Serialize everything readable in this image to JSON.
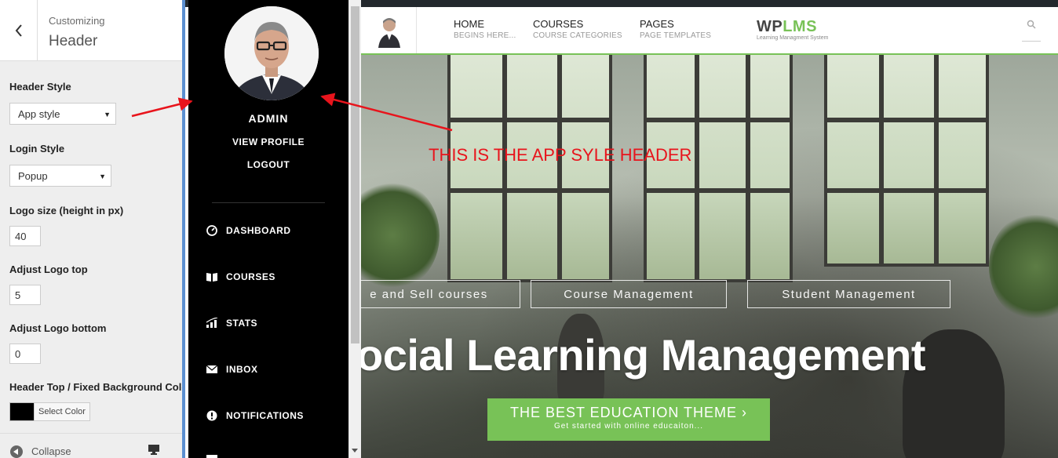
{
  "customizer": {
    "breadcrumb": "Customizing",
    "title": "Header",
    "fields": {
      "header_style": {
        "label": "Header Style",
        "value": "App style"
      },
      "login_style": {
        "label": "Login Style",
        "value": "Popup"
      },
      "logo_size": {
        "label": "Logo size (height in px)",
        "value": "40"
      },
      "logo_top": {
        "label": "Adjust Logo top",
        "value": "5"
      },
      "logo_bottom": {
        "label": "Adjust Logo bottom",
        "value": "0"
      },
      "header_bg": {
        "label": "Header Top / Fixed Background Color",
        "button": "Select Color",
        "swatch": "#000000"
      }
    },
    "footer": {
      "collapse_label": "Collapse"
    }
  },
  "app_panel": {
    "name": "ADMIN",
    "view_profile": "VIEW PROFILE",
    "logout": "LOGOUT",
    "menu": [
      {
        "label": "DASHBOARD",
        "icon": "dashboard-icon"
      },
      {
        "label": "COURSES",
        "icon": "book-icon"
      },
      {
        "label": "STATS",
        "icon": "stats-icon"
      },
      {
        "label": "INBOX",
        "icon": "envelope-icon"
      },
      {
        "label": "NOTIFICATIONS",
        "icon": "alert-icon"
      }
    ]
  },
  "site_header": {
    "menu": [
      {
        "label": "HOME",
        "sub": "BEGINS HERE..."
      },
      {
        "label": "COURSES",
        "sub": "COURSE CATEGORIES"
      },
      {
        "label": "PAGES",
        "sub": "PAGE TEMPLATES"
      }
    ],
    "logo_wp": "WP",
    "logo_lms": "LMS",
    "logo_sub": "Learning Managment System",
    "accent": "#78c257"
  },
  "hero": {
    "tags": [
      "e and Sell courses",
      "Course Management",
      "Student Management"
    ],
    "title": "ocial Learning Management",
    "cta_main": "THE BEST EDUCATION THEME ›",
    "cta_sub": "Get started with online educaiton..."
  },
  "annotation": {
    "text": "THIS IS THE APP SYLE HEADER",
    "color": "#e8141c"
  }
}
